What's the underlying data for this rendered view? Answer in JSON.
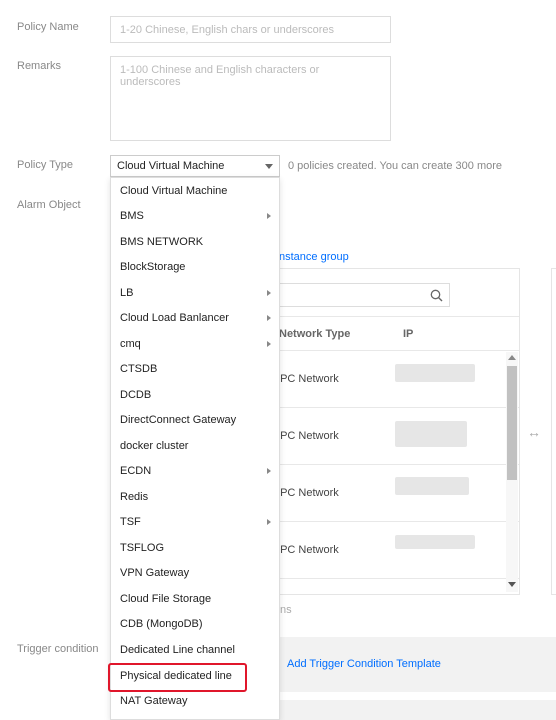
{
  "form": {
    "policy_name_label": "Policy Name",
    "policy_name_placeholder": "1-20 Chinese, English chars or underscores",
    "remarks_label": "Remarks",
    "remarks_placeholder": "1-100 Chinese and English characters or underscores",
    "policy_type_label": "Policy Type",
    "policy_type_value": "Cloud Virtual Machine",
    "policy_hint": "0 policies created. You can create 300 more",
    "alarm_object_label": "Alarm Object",
    "instance_group_link": "nstance group",
    "trigger_condition_label": "Trigger condition",
    "add_trigger_template_link": "Add Trigger Condition Template",
    "partial_text_ns": "ns"
  },
  "instance_table": {
    "columns": [
      "Network Type",
      "IP"
    ],
    "rows": [
      {
        "network_type": "'PC Network"
      },
      {
        "network_type": "'PC Network"
      },
      {
        "network_type": "'PC Network"
      },
      {
        "network_type": "'PC Network"
      }
    ],
    "transfer_icon": "↔"
  },
  "dropdown": {
    "items": [
      {
        "label": "Cloud Virtual Machine",
        "submenu": false
      },
      {
        "label": "BMS",
        "submenu": true
      },
      {
        "label": "BMS NETWORK",
        "submenu": false
      },
      {
        "label": "BlockStorage",
        "submenu": false
      },
      {
        "label": "LB",
        "submenu": true
      },
      {
        "label": "Cloud Load Banlancer",
        "submenu": true
      },
      {
        "label": "cmq",
        "submenu": true
      },
      {
        "label": "CTSDB",
        "submenu": false
      },
      {
        "label": "DCDB",
        "submenu": false
      },
      {
        "label": "DirectConnect Gateway",
        "submenu": false
      },
      {
        "label": "docker cluster",
        "submenu": false
      },
      {
        "label": "ECDN",
        "submenu": true
      },
      {
        "label": "Redis",
        "submenu": false
      },
      {
        "label": "TSF",
        "submenu": true
      },
      {
        "label": "TSFLOG",
        "submenu": false
      },
      {
        "label": "VPN Gateway",
        "submenu": false
      },
      {
        "label": "Cloud File Storage",
        "submenu": false
      },
      {
        "label": "CDB (MongoDB)",
        "submenu": false
      },
      {
        "label": "Dedicated Line channel",
        "submenu": false
      },
      {
        "label": "Physical dedicated line",
        "submenu": false,
        "highlighted": true
      },
      {
        "label": "NAT Gateway",
        "submenu": false
      }
    ]
  },
  "colors": {
    "link": "#006eff",
    "highlight_border": "#e0162b"
  }
}
